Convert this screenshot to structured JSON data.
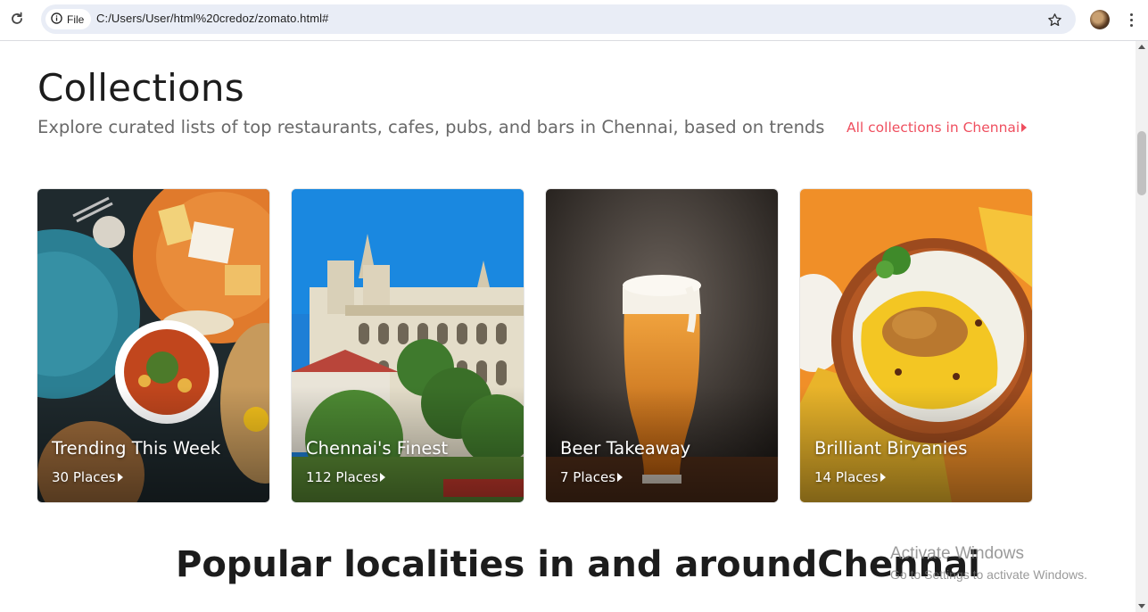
{
  "browser": {
    "chip_label": "File",
    "url": "C:/Users/User/html%20credoz/zomato.html#"
  },
  "collections": {
    "title": "Collections",
    "subtitle": "Explore curated lists of top restaurants, cafes, pubs, and bars in Chennai, based on trends",
    "all_link": "All collections in Chennai",
    "cards": [
      {
        "title": "Trending This Week",
        "count": "30 Places"
      },
      {
        "title": "Chennai's Finest",
        "count": "112 Places"
      },
      {
        "title": "Beer Takeaway",
        "count": "7 Places"
      },
      {
        "title": "Brilliant Biryanies",
        "count": "14 Places"
      }
    ]
  },
  "localities": {
    "heading_regular": "Popular localities in and around",
    "heading_bold": "Chennai"
  },
  "watermark": {
    "line1": "Activate Windows",
    "line2": "Go to Settings to activate Windows."
  },
  "colors": {
    "accent": "#ef4f5f",
    "text_primary": "#1c1c1c",
    "text_secondary": "#696969"
  }
}
